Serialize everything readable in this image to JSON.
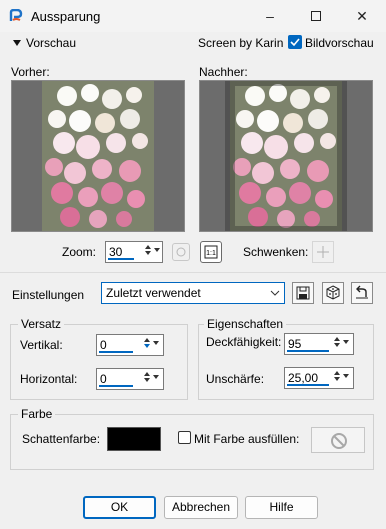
{
  "window": {
    "title": "Aussparung"
  },
  "header": {
    "preview_toggle_label": "Vorschau",
    "credit": "Screen by Karin",
    "image_preview_label": "Bildvorschau",
    "image_preview_checked": true
  },
  "previews": {
    "before_label": "Vorher:",
    "after_label": "Nachher:"
  },
  "zoom": {
    "label": "Zoom:",
    "value": "30",
    "pan_label": "Schwenken:"
  },
  "settings": {
    "label": "Einstellungen",
    "preset_value": "Zuletzt verwendet"
  },
  "offset": {
    "group_label": "Versatz",
    "vertical_label": "Vertikal:",
    "vertical_value": "0",
    "horizontal_label": "Horizontal:",
    "horizontal_value": "0"
  },
  "properties": {
    "group_label": "Eigenschaften",
    "opacity_label": "Deckfähigkeit:",
    "opacity_value": "95",
    "blur_label": "Unschärfe:",
    "blur_value": "25,00"
  },
  "color": {
    "group_label": "Farbe",
    "shadow_color_label": "Schattenfarbe:",
    "shadow_color": "#000000",
    "fill_label": "Mit Farbe ausfüllen:",
    "fill_checked": false
  },
  "buttons": {
    "ok": "OK",
    "cancel": "Abbrechen",
    "help": "Hilfe"
  },
  "colors": {
    "accent": "#0067c0"
  }
}
